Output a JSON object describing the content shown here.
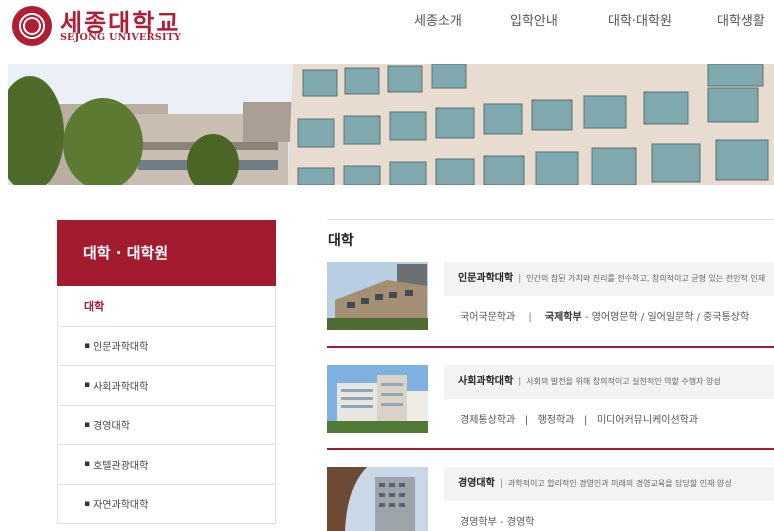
{
  "header": {
    "logo_kr": "세종대학교",
    "logo_en": "SEJONG UNIVERSITY",
    "nav": [
      "세종소개",
      "입학안내",
      "대학·대학원",
      "대학생활"
    ]
  },
  "sidebar": {
    "title": "대학 · 대학원",
    "items": [
      {
        "label": "대학",
        "active": true
      },
      {
        "label": "인문과학대학"
      },
      {
        "label": "사회과학대학"
      },
      {
        "label": "경영대학"
      },
      {
        "label": "호텔관광대학"
      },
      {
        "label": "자연과학대학"
      }
    ]
  },
  "content": {
    "title": "대학",
    "colleges": [
      {
        "name": "인문과학대학",
        "desc": "인간의 참된 가치와 진리를 전수하고, 창의적이고 균형 있는 전인적 인재",
        "dept_a": "국어국문학과",
        "dept_b_bold": "국제학부",
        "dept_b_rest": " - 영어영문학 / 일어일문학 / 중국통상학"
      },
      {
        "name": "사회과학대학",
        "desc": "사회의 발전을 위해 창의적이고 실천적인 역할 수행자 양성",
        "depts": "경제통상학과   |   행정학과   |   미디어커뮤니케이션학과"
      },
      {
        "name": "경영대학",
        "desc": "과학적이고 합리적인 경영인과 미래의 경영교육을 담당할 인재 양성",
        "depts": "경영학부 - 경영학"
      }
    ]
  }
}
